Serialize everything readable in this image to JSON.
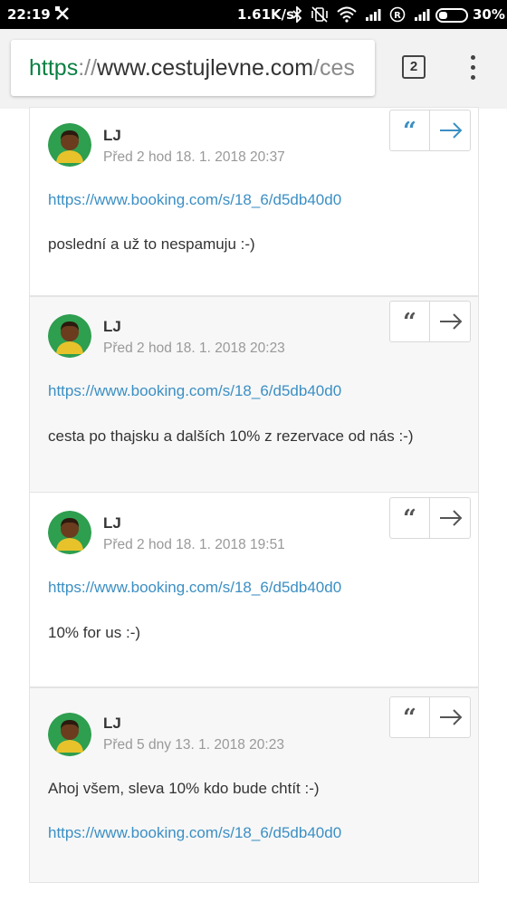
{
  "status_bar": {
    "time": "22:19",
    "network_speed": "1.61K/s",
    "battery_percent": "30%",
    "icons": [
      "tool-icon",
      "bluetooth-icon",
      "vibrate-off-icon",
      "wifi-icon",
      "signal-icon",
      "roaming-icon",
      "signal-icon",
      "battery-icon"
    ]
  },
  "browser": {
    "url_scheme": "https",
    "url_separator": "://",
    "url_host": "www.cestujlevne.com",
    "url_path": "/ces",
    "tab_count": "2",
    "menu_icon": "more-vert-icon"
  },
  "colors": {
    "link": "#3b8fc4",
    "quote_active": "#3b8fc4",
    "quote_inactive": "#555555",
    "post_bg_alt": "#f7f7f7"
  },
  "posts": [
    {
      "author": "LJ",
      "meta": "Před 2 hod 18. 1. 2018 20:37",
      "link": "https://www.booking.com/s/18_6/d5db40d0",
      "text": "poslední a už to nespamuju :-)",
      "highlighted_buttons": true
    },
    {
      "author": "LJ",
      "meta": "Před 2 hod 18. 1. 2018 20:23",
      "link": "https://www.booking.com/s/18_6/d5db40d0",
      "text": "cesta po thajsku a dalších 10% z rezervace od nás :-)",
      "highlighted_buttons": false
    },
    {
      "author": "LJ",
      "meta": "Před 2 hod 18. 1. 2018 19:51",
      "link": "https://www.booking.com/s/18_6/d5db40d0",
      "text": "10% for us :-)",
      "highlighted_buttons": false
    },
    {
      "author": "LJ",
      "meta": "Před 5 dny 13. 1. 2018 20:23",
      "text": "Ahoj všem, sleva 10% kdo bude chtít :-)",
      "link": "https://www.booking.com/s/18_6/d5db40d0",
      "highlighted_buttons": false
    }
  ],
  "buttons": {
    "quote_glyph": "“",
    "quote_icon": "quote-icon",
    "reply_icon": "arrow-right-icon"
  }
}
